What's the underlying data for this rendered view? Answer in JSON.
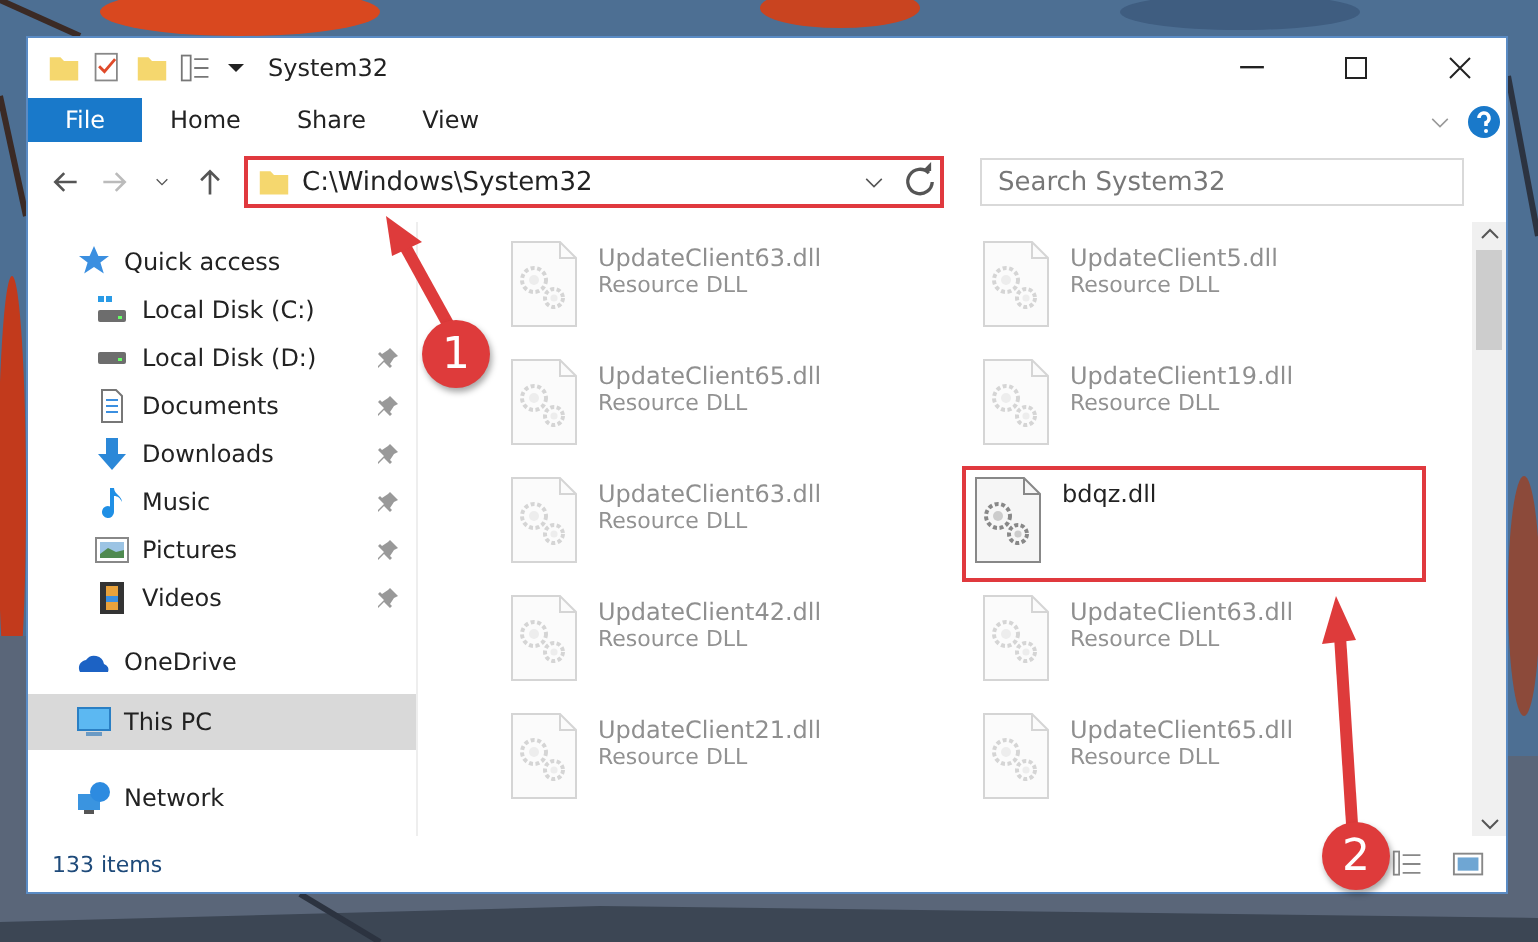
{
  "window": {
    "title": "System32"
  },
  "ribbon_tabs": [
    {
      "label": "File",
      "kind": "menu"
    },
    {
      "label": "Home",
      "kind": "tab"
    },
    {
      "label": "Share",
      "kind": "tab"
    },
    {
      "label": "View",
      "kind": "tab"
    }
  ],
  "address_bar": {
    "path": "C:\\Windows\\System32",
    "highlighted": true
  },
  "search": {
    "placeholder": "Search System32"
  },
  "sidebar": {
    "items": [
      {
        "label": "Quick access",
        "selected": false,
        "children": [
          {
            "label": "Local Disk (C:)",
            "pinned": false,
            "selected": false
          },
          {
            "label": "Local Disk (D:)",
            "pinned": true,
            "selected": false
          },
          {
            "label": "Documents",
            "pinned": true,
            "selected": false
          },
          {
            "label": "Downloads",
            "pinned": true,
            "selected": false
          },
          {
            "label": "Music",
            "pinned": true,
            "selected": false
          },
          {
            "label": "Pictures",
            "pinned": true,
            "selected": false
          },
          {
            "label": "Videos",
            "pinned": true,
            "selected": false
          }
        ]
      },
      {
        "label": "OneDrive",
        "selected": false
      },
      {
        "label": "This PC",
        "selected": true
      },
      {
        "label": "Network",
        "selected": false
      }
    ]
  },
  "files": [
    {
      "name": "UpdateClient63.dll",
      "type": "Resource DLL",
      "blurred": true,
      "highlighted": false
    },
    {
      "name": "UpdateClient5.dll",
      "type": "Resource DLL",
      "blurred": true,
      "highlighted": false
    },
    {
      "name": "UpdateClient65.dll",
      "type": "Resource DLL",
      "blurred": true,
      "highlighted": false
    },
    {
      "name": "UpdateClient19.dll",
      "type": "Resource DLL",
      "blurred": true,
      "highlighted": false
    },
    {
      "name": "UpdateClient63.dll",
      "type": "Resource DLL",
      "blurred": true,
      "highlighted": false
    },
    {
      "name": "bdqz.dll",
      "blurred": false,
      "highlighted": true
    },
    {
      "name": "UpdateClient42.dll",
      "type": "Resource DLL",
      "blurred": true,
      "highlighted": false
    },
    {
      "name": "UpdateClient63.dll",
      "type": "Resource DLL",
      "blurred": true,
      "highlighted": false
    },
    {
      "name": "UpdateClient21.dll",
      "type": "Resource DLL",
      "blurred": true,
      "highlighted": false
    },
    {
      "name": "UpdateClient65.dll",
      "type": "Resource DLL",
      "blurred": true,
      "highlighted": false
    }
  ],
  "status_bar": {
    "count": "133 items"
  },
  "annotations": [
    {
      "number": "1"
    },
    {
      "number": "2"
    }
  ]
}
